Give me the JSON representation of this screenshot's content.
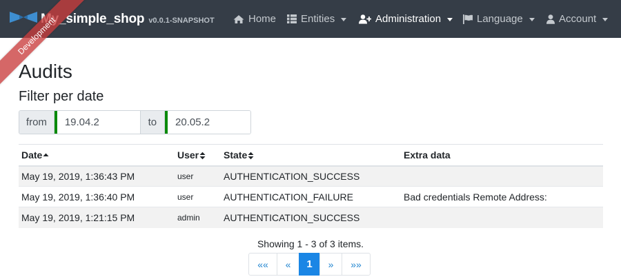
{
  "navbar": {
    "brand_name": "My_simple_shop",
    "brand_version": "v0.0.1-SNAPSHOT",
    "items": [
      {
        "label": "Home",
        "icon": "home-icon"
      },
      {
        "label": "Entities",
        "icon": "list-icon"
      },
      {
        "label": "Administration",
        "icon": "user-plus-icon"
      },
      {
        "label": "Language",
        "icon": "flag-icon"
      },
      {
        "label": "Account",
        "icon": "user-icon"
      }
    ],
    "active_item": "Administration"
  },
  "ribbon": {
    "label": "Development"
  },
  "page": {
    "title": "Audits",
    "filter_title": "Filter per date",
    "from_label": "from",
    "from_value": "19.04.2",
    "to_label": "to",
    "to_value": "20.05.2"
  },
  "table": {
    "headers": {
      "date": "Date",
      "user": "User",
      "state": "State",
      "extra": "Extra data"
    },
    "rows": [
      {
        "date": "May 19, 2019, 1:36:43 PM",
        "user": "user",
        "state": "AUTHENTICATION_SUCCESS",
        "extra": ""
      },
      {
        "date": "May 19, 2019, 1:36:40 PM",
        "user": "user",
        "state": "AUTHENTICATION_FAILURE",
        "extra": "Bad credentials Remote Address:"
      },
      {
        "date": "May 19, 2019, 1:21:15 PM",
        "user": "admin",
        "state": "AUTHENTICATION_SUCCESS",
        "extra": ""
      }
    ]
  },
  "pagination": {
    "summary": "Showing 1 - 3 of 3 items.",
    "first": "««",
    "prev": "«",
    "current": "1",
    "next": "»",
    "last": "»»"
  },
  "colors": {
    "navbar_bg": "#353d47",
    "ribbon": "#c93c3c",
    "accent": "#1a86e5",
    "input_valid_border": "#0a8a0a"
  }
}
